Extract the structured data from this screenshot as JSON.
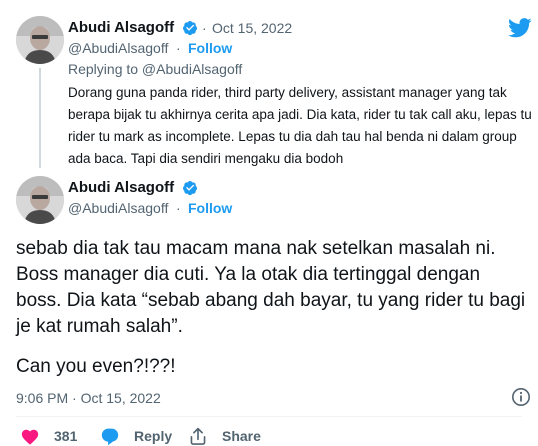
{
  "reply_tweet": {
    "name": "Abudi Alsagoff",
    "date": "Oct 15, 2022",
    "handle": "@AbudiAlsagoff",
    "follow_label": "Follow",
    "replying_to": "Replying to @AbudiAlsagoff",
    "text": "Dorang guna panda rider, third party delivery, assistant manager yang tak berapa bijak tu akhirnya cerita apa jadi. Dia kata, rider tu tak call aku, lepas tu rider tu mark as incomplete. Lepas tu dia dah tau hal benda ni dalam group ada baca. Tapi dia sendiri mengaku dia bodoh"
  },
  "main_tweet": {
    "name": "Abudi Alsagoff",
    "handle": "@AbudiAlsagoff",
    "follow_label": "Follow",
    "text_para1": "sebab dia tak tau macam mana nak setelkan masalah ni. Boss manager dia cuti. Ya la otak dia tertinggal dengan boss. Dia kata “sebab abang dah bayar, tu yang rider tu bagi je kat rumah salah”.",
    "text_para2": "Can you even?!??!",
    "timestamp": "9:06 PM · Oct 15, 2022"
  },
  "actions": {
    "like_count": "381",
    "reply_label": "Reply",
    "share_label": "Share"
  },
  "colors": {
    "twitter_blue": "#1d9bf0",
    "like_red": "#f91880",
    "secondary_text": "#536471"
  },
  "icons": [
    "twitter-logo-icon",
    "verified-badge-icon",
    "info-icon",
    "heart-icon",
    "reply-icon",
    "share-icon"
  ]
}
